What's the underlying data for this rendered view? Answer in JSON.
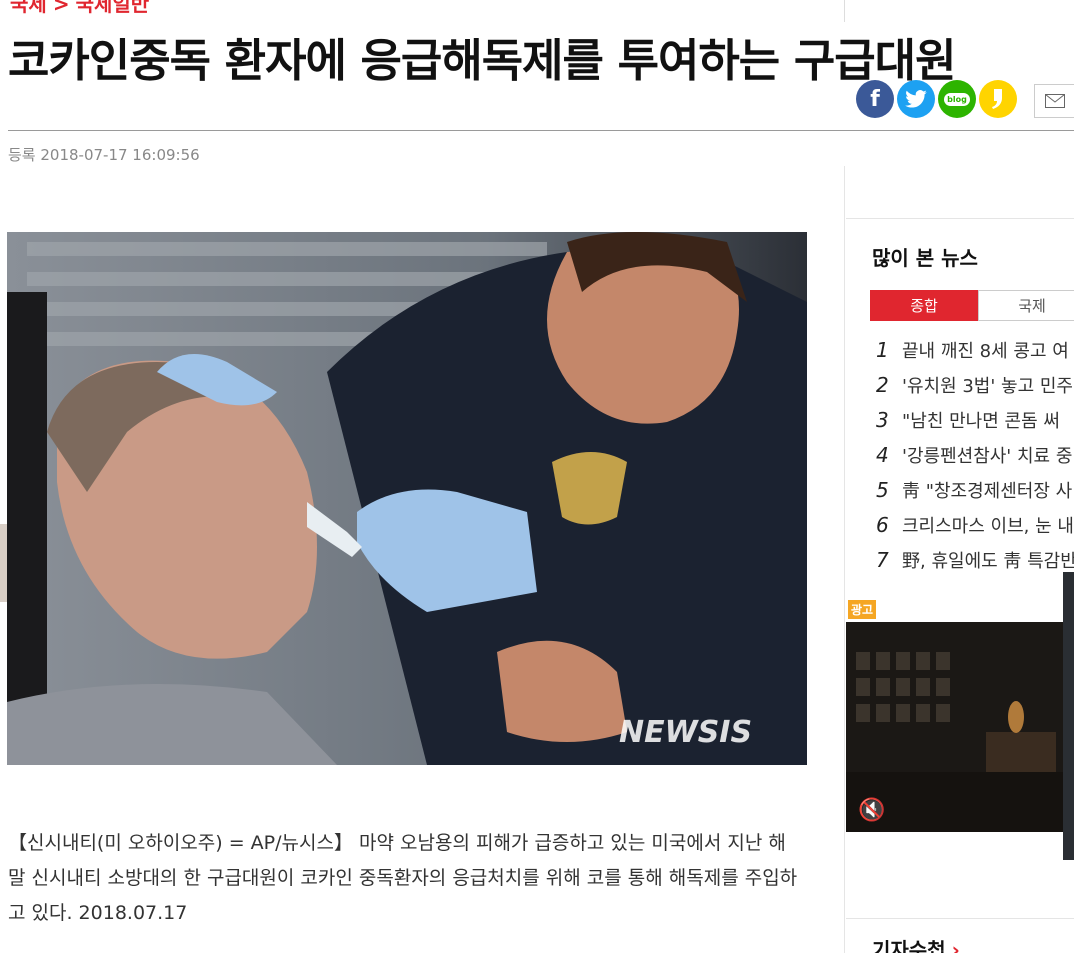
{
  "breadcrumb": {
    "first": "국제",
    "second": "국제일반"
  },
  "article": {
    "title": "코카인중독 환자에 응급해독제를 투여하는 구급대원",
    "date": "등록 2018-07-17 16:09:56",
    "photo_watermark": "NEWSIS",
    "caption": "【신시내티(미 오하이오주) = AP/뉴시스】 마약 오남용의 피해가 급증하고 있는 미국에서 지난 해 말 신시내티 소방대의 한 구급대원이 코카인 중독환자의 응급처치를 위해 코를 통해 해독제를 주입하고 있다. 2018.07.17"
  },
  "share": {
    "facebook_glyph": "f",
    "blog_label": "blog",
    "icons": [
      "facebook-icon",
      "twitter-icon",
      "blog-icon",
      "kakaostory-icon",
      "mail-icon"
    ]
  },
  "sidebar": {
    "title": "많이 본 뉴스",
    "tabs": [
      {
        "label": "종합"
      },
      {
        "label": "국제"
      }
    ],
    "news": [
      {
        "num": "1",
        "text": "끝내 깨진 8세 콩고 여"
      },
      {
        "num": "2",
        "text": "'유치원 3법' 놓고 민주"
      },
      {
        "num": "3",
        "text": "\"남친 만나면 콘돔 써"
      },
      {
        "num": "4",
        "text": "'강릉펜션참사' 치료 중"
      },
      {
        "num": "5",
        "text": "靑 \"창조경제센터장 사"
      },
      {
        "num": "6",
        "text": "크리스마스 이브, 눈 내"
      },
      {
        "num": "7",
        "text": "野, 휴일에도 靑 특감반"
      }
    ],
    "ad_label": "광고",
    "mute_glyph": "🔇",
    "footer_title": "기자수첩",
    "footer_arrow": "›"
  },
  "side_close_glyph": "×",
  "colors": {
    "accent": "#e0262f",
    "facebook": "#3b5998",
    "twitter": "#1da1f2",
    "blog": "#2db400",
    "kakao": "#ffd400"
  }
}
